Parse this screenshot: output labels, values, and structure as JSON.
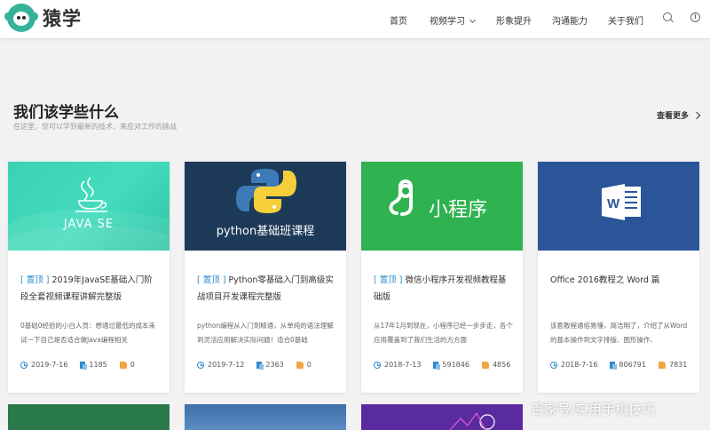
{
  "brand": {
    "name": "猿学"
  },
  "nav": {
    "home": "首页",
    "video": "视频学习",
    "image_up": "形象提升",
    "comm": "沟通能力",
    "about": "关于我们"
  },
  "section": {
    "title": "我们该学些什么",
    "subtitle": "在这里，您可以学到最新的技术，来应对工作的挑战",
    "more": "查看更多"
  },
  "cards": [
    {
      "cover_text": "JAVA SE",
      "tag": "[ 置顶 ]",
      "title": "2019年JavaSE基础入门阶段全套视频课程讲解完整版",
      "desc": "0基础0经验的小白人员：想通过最低的成本来试一下自己是否适合做Java编程相关",
      "date": "2019-7-16",
      "views": "1185",
      "likes": "0"
    },
    {
      "cover_text": "python基础班课程",
      "tag": "[ 置顶 ]",
      "title": "Python零基础入门到高级实战项目开发课程完整版",
      "desc": "python编程从入门到精通，从单纯的语法理解到灵活应用解决实际问题！适合0基础",
      "date": "2019-7-12",
      "views": "2363",
      "likes": "0"
    },
    {
      "cover_text": "小程序",
      "tag": "[ 置顶 ]",
      "title": "微信小程序开发视频教程基础版",
      "desc": "从17年1月到现在，小程序已经一步步走，各个应用覆盖到了我们生活的方方面",
      "date": "2018-7-13",
      "views": "591846",
      "likes": "4856"
    },
    {
      "cover_text": "",
      "tag": "",
      "title": "Office 2016教程之 Word 篇",
      "desc": "该套教程通俗易懂，简洁明了，介绍了从Word的基本操作到文字排版、图形操作、",
      "date": "2018-7-16",
      "views": "806791",
      "likes": "7831"
    }
  ],
  "watermark": "百家号/实用手机技巧",
  "colors": {
    "accent": "#2b8ad1",
    "brand": "#34b39a",
    "java_cover": "#3fd3b4",
    "python_cover": "#1d3a58",
    "mini_cover": "#2fb24f",
    "word_cover": "#2a5699"
  }
}
